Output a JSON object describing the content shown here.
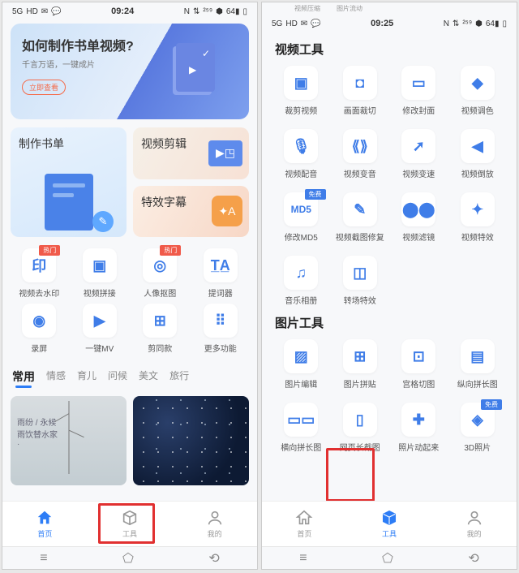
{
  "status": {
    "left": [
      "5G",
      "HD",
      "✉",
      "💬"
    ],
    "time_l": "09:24",
    "time_r": "09:25",
    "right": [
      "N",
      "⇅",
      "²⁵⁹",
      "⬢",
      "64▮",
      "▯"
    ]
  },
  "top_tags": [
    "视频压缩",
    "图片流动"
  ],
  "hero": {
    "title": "如何制作书单视频?",
    "subtitle": "千言万语，一键成片",
    "cta": "立即查看"
  },
  "cards": {
    "a": "制作书单",
    "b": "视频剪辑",
    "c": "特效字幕"
  },
  "tools_left": [
    {
      "label": "视频去水印",
      "icon": "印",
      "badge": "热门"
    },
    {
      "label": "视频拼接",
      "icon": "▣",
      "badge": null
    },
    {
      "label": "人像抠图",
      "icon": "◎",
      "badge": "热门"
    },
    {
      "label": "提词器",
      "icon": "T̲A̲",
      "badge": null
    },
    {
      "label": "录屏",
      "icon": "◉",
      "badge": null
    },
    {
      "label": "一键MV",
      "icon": "▶",
      "badge": null
    },
    {
      "label": "剪同款",
      "icon": "⊞",
      "badge": null
    },
    {
      "label": "更多功能",
      "icon": "⠿",
      "badge": null
    }
  ],
  "tabs": [
    "常用",
    "情感",
    "育儿",
    "问候",
    "美文",
    "旅行"
  ],
  "tab_active": 0,
  "template_cards": {
    "t1_line1": "雨纷 / 永候",
    "t1_line2": "雨饮替水家",
    "t1_line3": "·"
  },
  "nav": [
    {
      "label": "首页",
      "active_l": true,
      "active_r": false
    },
    {
      "label": "工具",
      "active_l": false,
      "active_r": true
    },
    {
      "label": "我的",
      "active_l": false,
      "active_r": false
    }
  ],
  "right": {
    "section1": "视频工具",
    "section2": "图片工具",
    "video_tools": [
      {
        "label": "裁剪视频",
        "icon": "▣"
      },
      {
        "label": "画面裁切",
        "icon": "◘"
      },
      {
        "label": "修改封面",
        "icon": "▭"
      },
      {
        "label": "视频调色",
        "icon": "◆"
      },
      {
        "label": "视频配音",
        "icon": "🎙"
      },
      {
        "label": "视频变音",
        "icon": "⟪⟫"
      },
      {
        "label": "视频变速",
        "icon": "➚"
      },
      {
        "label": "视频倒放",
        "icon": "◀"
      },
      {
        "label": "修改MD5",
        "icon": "MD5",
        "badge": "免费"
      },
      {
        "label": "视频截图修复",
        "icon": "✎"
      },
      {
        "label": "视频滤镜",
        "icon": "⬤⬤"
      },
      {
        "label": "视频特效",
        "icon": "✦"
      },
      {
        "label": "音乐相册",
        "icon": "♫"
      },
      {
        "label": "转场特效",
        "icon": "◫"
      }
    ],
    "image_tools": [
      {
        "label": "图片编辑",
        "icon": "▨"
      },
      {
        "label": "图片拼贴",
        "icon": "⊞"
      },
      {
        "label": "宫格切图",
        "icon": "⊡"
      },
      {
        "label": "纵向拼长图",
        "icon": "▤"
      },
      {
        "label": "横向拼长图",
        "icon": "▭▭"
      },
      {
        "label": "网页长截图",
        "icon": "▯"
      },
      {
        "label": "照片动起来",
        "icon": "✚"
      },
      {
        "label": "3D照片",
        "icon": "◈",
        "badge": "免费"
      }
    ]
  }
}
